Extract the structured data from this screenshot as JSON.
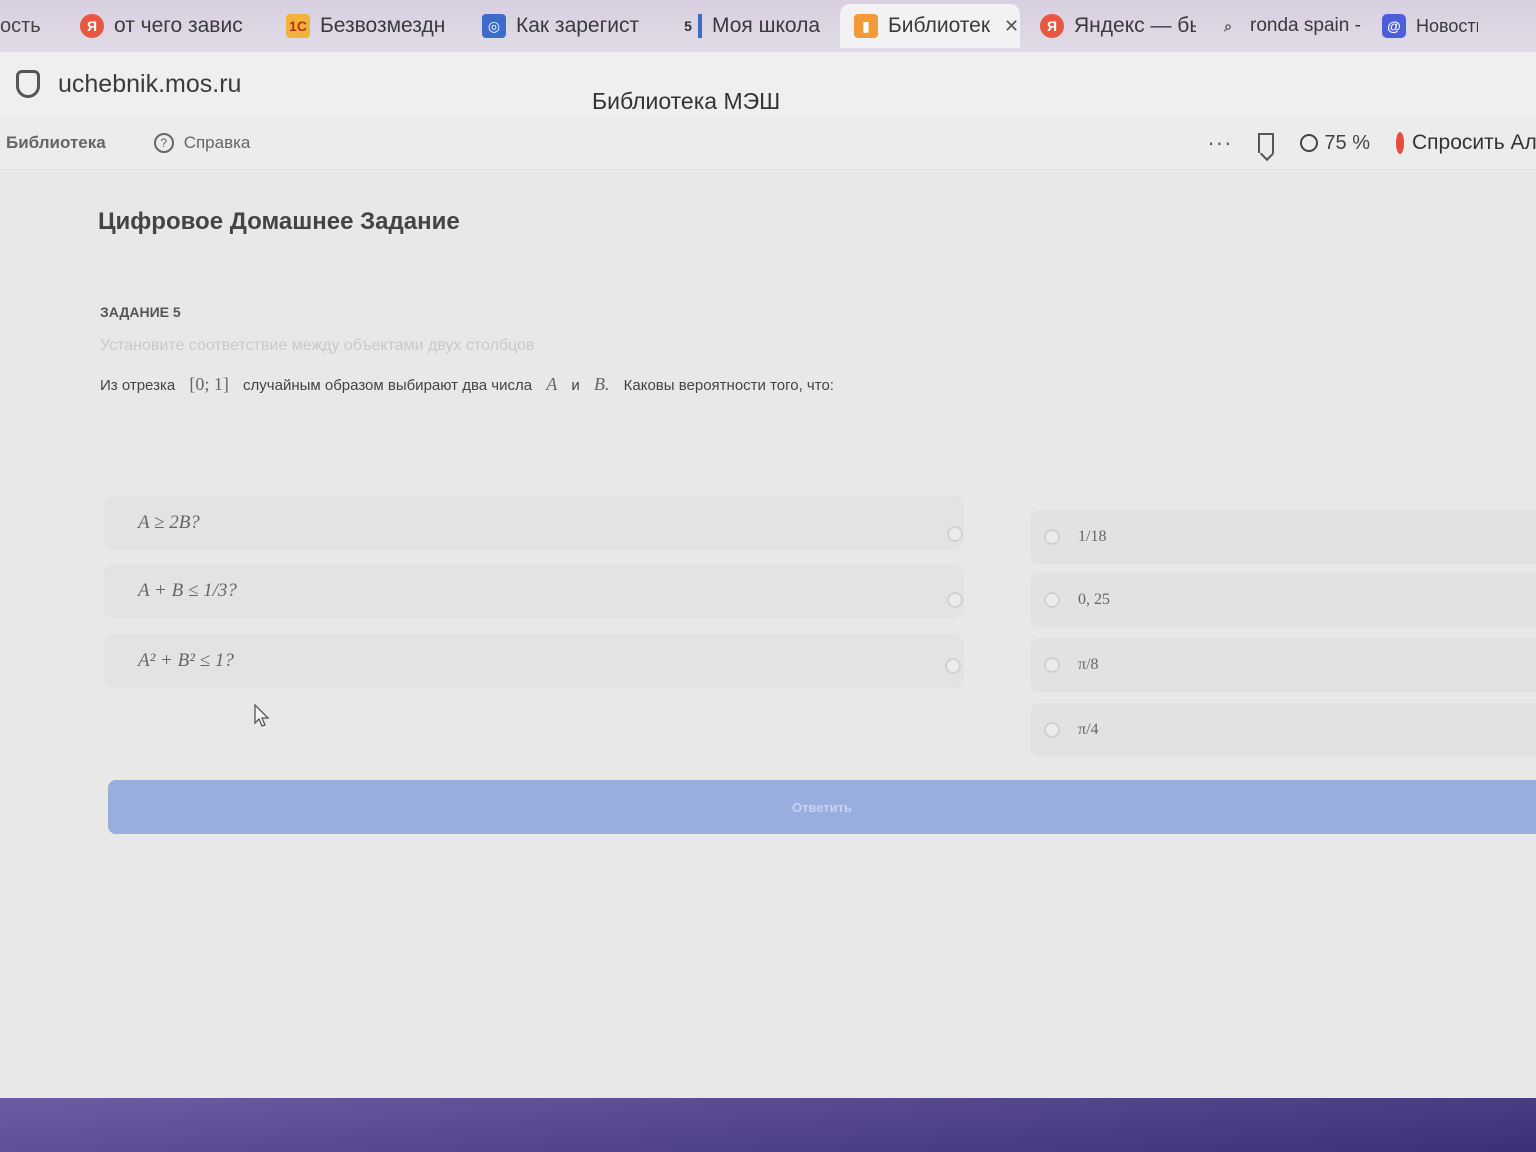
{
  "browser": {
    "tabs": [
      {
        "label": "ость",
        "icon": "none"
      },
      {
        "label": "от чего завис",
        "icon": "yandex-icon"
      },
      {
        "label": "Безвозмездн",
        "icon": "1c-icon"
      },
      {
        "label": "Как зарегист",
        "icon": "gamepad-icon"
      },
      {
        "label": "Моя школа",
        "icon": "school-icon",
        "badge": "5"
      },
      {
        "label": "Библиотек",
        "icon": "library-icon",
        "active": true
      },
      {
        "label": "Яндекс — бы",
        "icon": "yandex-icon"
      },
      {
        "label": "ronda spain -",
        "icon": "search-icon"
      },
      {
        "label": "Новость",
        "icon": "news-icon"
      }
    ],
    "url": "uchebnik.mos.ru",
    "page_title": "Библиотека МЭШ",
    "zoom": "75 %",
    "ask_label": "Спросить Ал"
  },
  "toolbar": {
    "breadcrumb": "Библиотека",
    "help_label": "Справка",
    "help_icon_glyph": "?",
    "more_label": "···"
  },
  "page": {
    "heading": "Цифровое Домашнее Задание",
    "task_label": "ЗАДАНИЕ 5",
    "instruction": "Установите соответствие между объектами двух столбцов",
    "problem": {
      "part1": "Из отрезка",
      "interval": "[0; 1]",
      "part2": "случайным образом выбирают два числа",
      "var_a": "A",
      "conj": "и",
      "var_b": "B.",
      "part3": "Каковы вероятности того, что:"
    },
    "left_items": [
      "A ≥ 2B?",
      "A + B ≤ 1/3?",
      "A² + B² ≤ 1?"
    ],
    "right_items": [
      "1/18",
      "0, 25",
      "π/8",
      "π/4"
    ],
    "submit_label": "Ответить"
  }
}
